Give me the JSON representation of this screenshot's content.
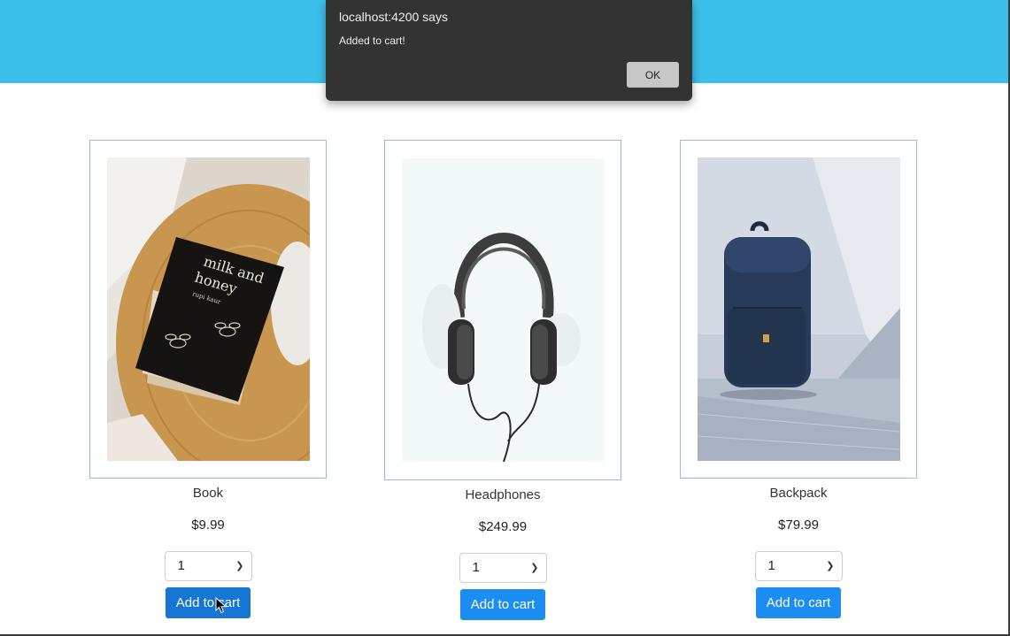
{
  "alert": {
    "title": "localhost:4200 says",
    "message": "Added to cart!",
    "ok_label": "OK"
  },
  "products": [
    {
      "name": "Book",
      "price": "$9.99",
      "quantity": "1",
      "add_label": "Add to cart",
      "image": "book-image"
    },
    {
      "name": "Headphones",
      "price": "$249.99",
      "quantity": "1",
      "add_label": "Add to cart",
      "image": "headphones-image"
    },
    {
      "name": "Backpack",
      "price": "$79.99",
      "quantity": "1",
      "add_label": "Add to cart",
      "image": "backpack-image"
    }
  ],
  "book_cover": {
    "title_line1": "milk and",
    "title_line2": "honey",
    "author": "rupi kaur"
  },
  "colors": {
    "banner": "#3bbfea",
    "button": "#1c8ef2",
    "dialog": "#333333"
  }
}
